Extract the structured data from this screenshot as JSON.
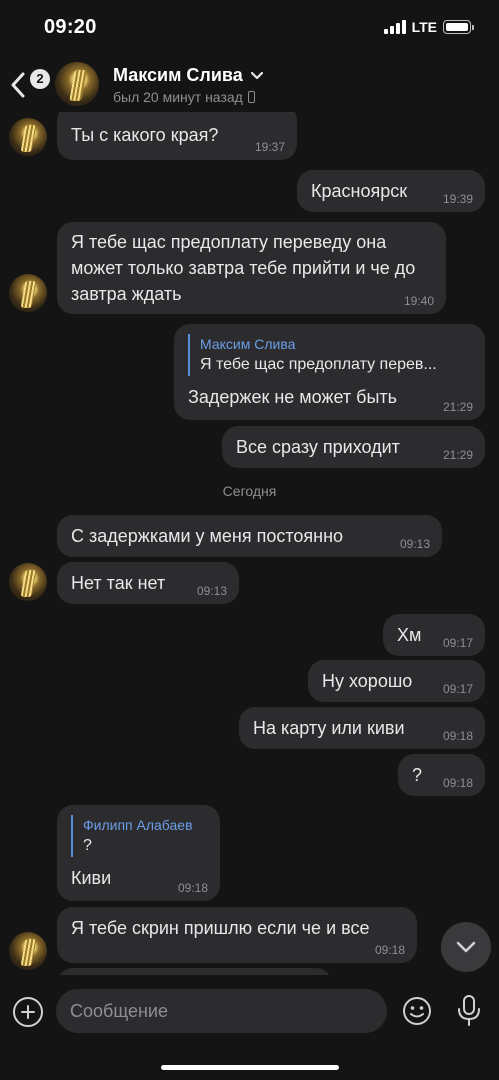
{
  "status_bar": {
    "time": "09:20",
    "network": "LTE"
  },
  "header": {
    "back_badge": "2",
    "contact_name": "Максим Слива",
    "contact_status": "был 20 минут назад"
  },
  "messages": [
    {
      "side": "in",
      "text": "Ты с какого края?",
      "time": "19:37"
    },
    {
      "side": "out",
      "text": "Красноярск",
      "time": "19:39"
    },
    {
      "side": "in",
      "text": "Я тебе щас предоплату переведу она может только завтра тебе прийти и че до завтра ждать",
      "time": "19:40"
    },
    {
      "side": "out",
      "reply_name": "Максим Слива",
      "reply_text": "Я тебе щас предоплату перев...",
      "text": "Задержек не может быть",
      "time": "21:29"
    },
    {
      "side": "out",
      "text": "Все сразу приходит",
      "time": "21:29"
    },
    {
      "side": "in",
      "text": "С задержками у меня  постоянно",
      "time": "09:13"
    },
    {
      "side": "in",
      "text": "Нет так нет",
      "time": "09:13"
    },
    {
      "side": "out",
      "text": "Хм",
      "time": "09:17"
    },
    {
      "side": "out",
      "text": "Ну хорошо",
      "time": "09:17"
    },
    {
      "side": "out",
      "text": "На карту или киви",
      "time": "09:18"
    },
    {
      "side": "out",
      "text": "?",
      "time": "09:18"
    },
    {
      "side": "in",
      "reply_name": "Филипп Алабаев",
      "reply_text": "?",
      "text": "Киви",
      "time": "09:18"
    },
    {
      "side": "in",
      "text": "Я тебе скрин пришлю если че и все",
      "time": "09:18"
    }
  ],
  "date_separator": "Сегодня",
  "composer": {
    "placeholder": "Сообщение"
  },
  "icons": {
    "back": "chevron-left-icon",
    "chevron": "chevron-down-icon",
    "device": "phone-icon",
    "add": "plus-circle-icon",
    "emoji": "smiley-icon",
    "mic": "microphone-icon",
    "scroll": "chevron-down-icon"
  },
  "colors": {
    "background": "#141414",
    "bubble": "#2c2c2e",
    "reply_accent": "#6c9ee8",
    "secondary_text": "#8e8e93"
  }
}
